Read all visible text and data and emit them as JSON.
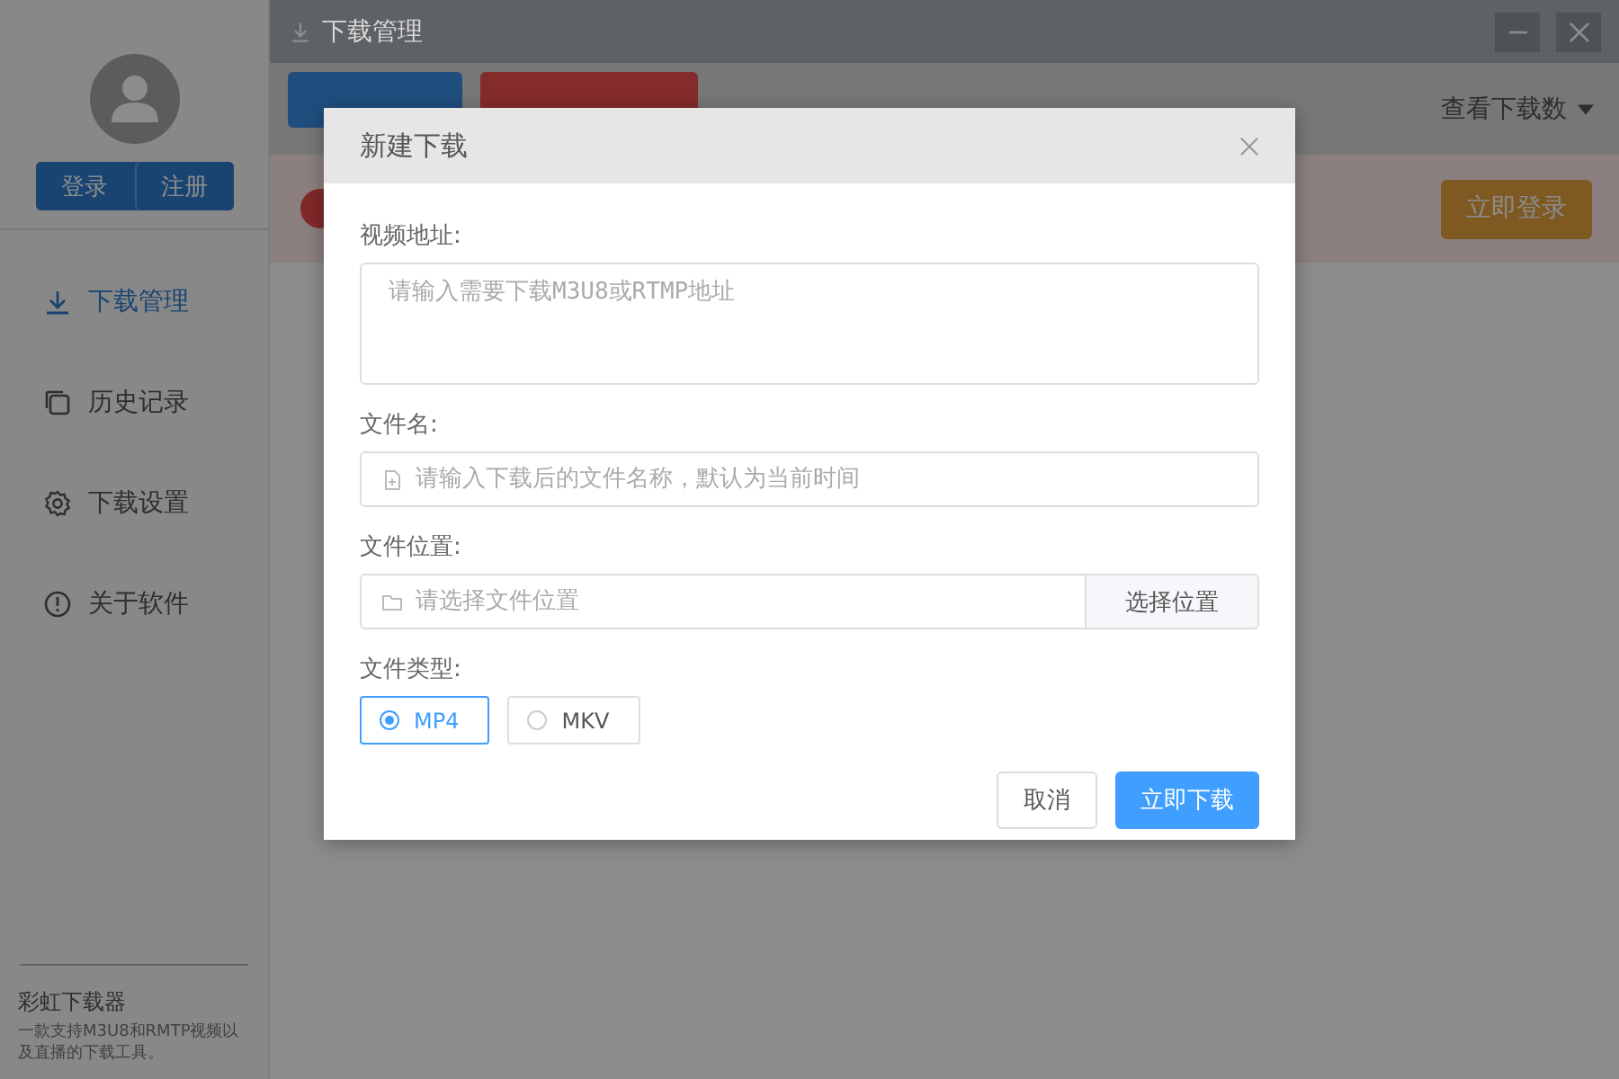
{
  "sidebar": {
    "login_button": "登录",
    "register_button": "注册",
    "items": [
      {
        "label": "下载管理",
        "kind": "download",
        "selected": true
      },
      {
        "label": "历史记录",
        "kind": "history",
        "selected": false
      },
      {
        "label": "下载设置",
        "kind": "settings",
        "selected": false
      },
      {
        "label": "关于软件",
        "kind": "about",
        "selected": false
      }
    ],
    "app_name": "彩虹下载器",
    "app_description": "一款支持M3U8和RMTP视频以及直播的下载工具。"
  },
  "window": {
    "title": "下载管理"
  },
  "toolbar": {
    "buttons": [
      {
        "kind": "primary"
      },
      {
        "kind": "danger"
      }
    ],
    "count_dropdown": "查看下载数"
  },
  "notice": {
    "button": "立即登录"
  },
  "dialog": {
    "title": "新建下载",
    "video_address": {
      "label": "视频地址:",
      "placeholder": "请输入需要下载M3U8或RTMP地址"
    },
    "file_name": {
      "label": "文件名:",
      "placeholder": "请输入下载后的文件名称，默认为当前时间"
    },
    "file_location": {
      "label": "文件位置:",
      "placeholder": "请选择文件位置",
      "button": "选择位置"
    },
    "file_type": {
      "label": "文件类型:",
      "options": [
        {
          "label": "MP4",
          "selected": true
        },
        {
          "label": "MKV",
          "selected": false
        }
      ]
    },
    "cancel_button": "取消",
    "confirm_button": "立即下载"
  }
}
